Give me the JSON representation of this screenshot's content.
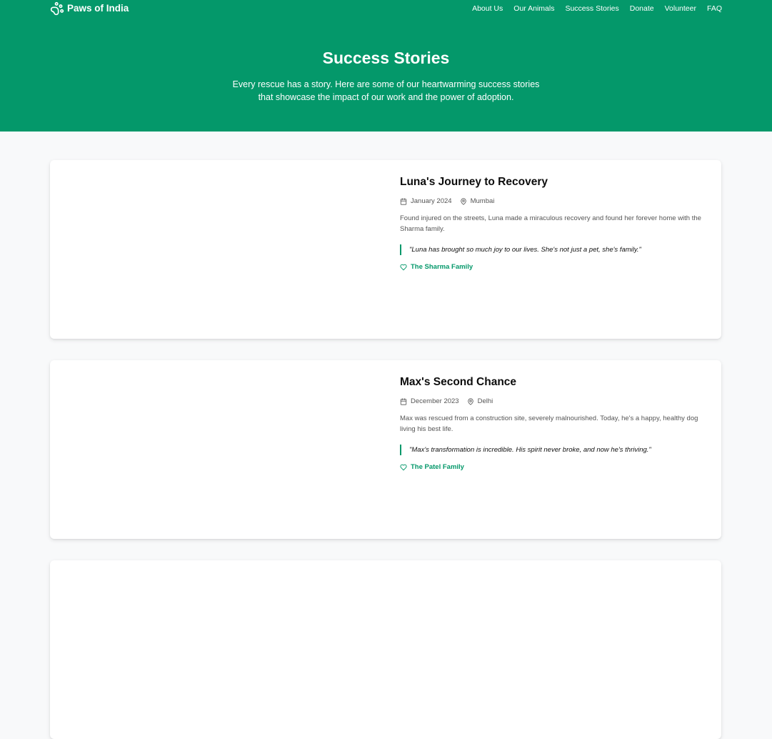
{
  "brand": {
    "name": "Paws of India",
    "icon": "paw-icon"
  },
  "nav": [
    "About Us",
    "Our Animals",
    "Success Stories",
    "Donate",
    "Volunteer",
    "FAQ"
  ],
  "hero": {
    "title": "Success Stories",
    "subtitle": "Every rescue has a story. Here are some of our heartwarming success stories that showcase the impact of our work and the power of adoption."
  },
  "colors": {
    "accent": "#04986a",
    "background": "#f8f9fa",
    "card": "#ffffff"
  },
  "stories": [
    {
      "title": "Luna's Journey to Recovery",
      "date": "January 2024",
      "location": "Mumbai",
      "description": "Found injured on the streets, Luna made a miraculous recovery and found her forever home with the Sharma family.",
      "quote": "\"Luna has brought so much joy to our lives. She's not just a pet, she's family.\"",
      "family": "The Sharma Family"
    },
    {
      "title": "Max's Second Chance",
      "date": "December 2023",
      "location": "Delhi",
      "description": "Max was rescued from a construction site, severely malnourished. Today, he's a happy, healthy dog living his best life.",
      "quote": "\"Max's transformation is incredible. His spirit never broke, and now he's thriving.\"",
      "family": "The Patel Family"
    }
  ]
}
